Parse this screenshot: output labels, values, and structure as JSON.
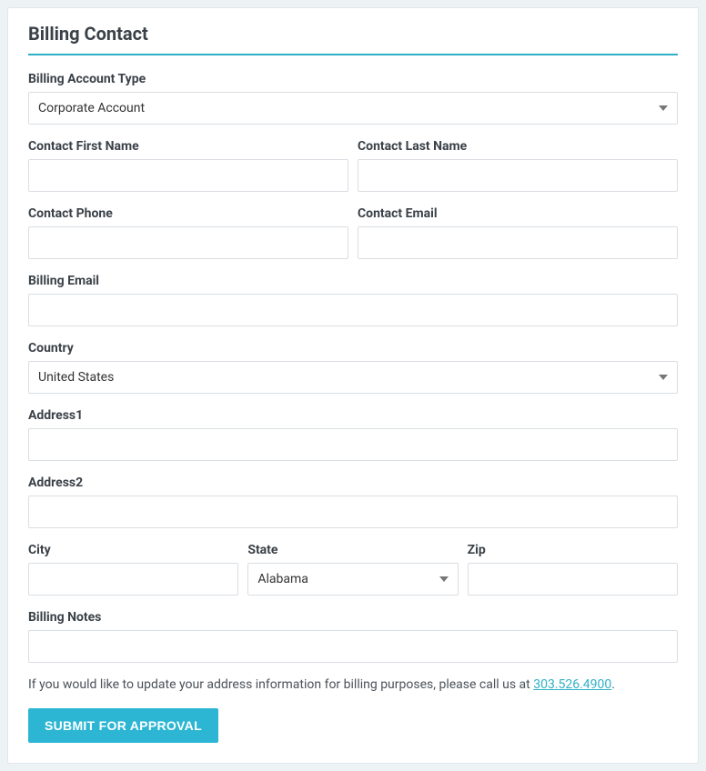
{
  "section": {
    "title": "Billing Contact"
  },
  "fields": {
    "account_type": {
      "label": "Billing Account Type",
      "value": "Corporate Account"
    },
    "first_name": {
      "label": "Contact First Name",
      "value": ""
    },
    "last_name": {
      "label": "Contact Last Name",
      "value": ""
    },
    "phone": {
      "label": "Contact Phone",
      "value": ""
    },
    "email": {
      "label": "Contact Email",
      "value": ""
    },
    "billing_email": {
      "label": "Billing Email",
      "value": ""
    },
    "country": {
      "label": "Country",
      "value": "United States"
    },
    "address1": {
      "label": "Address1",
      "value": ""
    },
    "address2": {
      "label": "Address2",
      "value": ""
    },
    "city": {
      "label": "City",
      "value": ""
    },
    "state": {
      "label": "State",
      "value": "Alabama"
    },
    "zip": {
      "label": "Zip",
      "value": ""
    },
    "notes": {
      "label": "Billing Notes",
      "value": ""
    }
  },
  "hint": {
    "prefix": "If you would like to update your address information for billing purposes, please call us at ",
    "phone": "303.526.4900",
    "suffix": "."
  },
  "buttons": {
    "submit": "SUBMIT FOR APPROVAL"
  }
}
